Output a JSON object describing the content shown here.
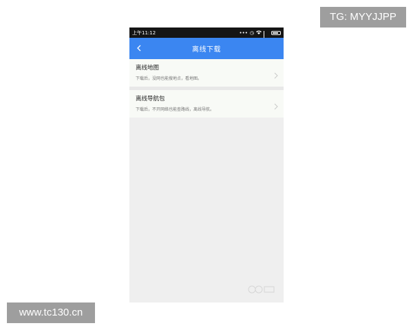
{
  "overlay": {
    "tg": "TG: MYYJJPP",
    "site": "www.tc130.cn"
  },
  "status_bar": {
    "time": "上午11:12",
    "icons": [
      "more-icon",
      "alarm-icon",
      "wifi-icon",
      "signal-icon",
      "battery-icon"
    ]
  },
  "app_bar": {
    "title": "离线下载",
    "back_icon": "chevron-left-icon"
  },
  "list": {
    "items": [
      {
        "title": "离线地图",
        "desc": "下载后，没网也能搜地点，看地图。"
      },
      {
        "title": "离线导航包",
        "desc": "下载后，不开网络也能查路线，离线导航。"
      }
    ]
  },
  "colors": {
    "status_bar": "#151515",
    "app_bar": "#3b86f1",
    "background": "#efefef",
    "item_background": "#f8faf6"
  }
}
